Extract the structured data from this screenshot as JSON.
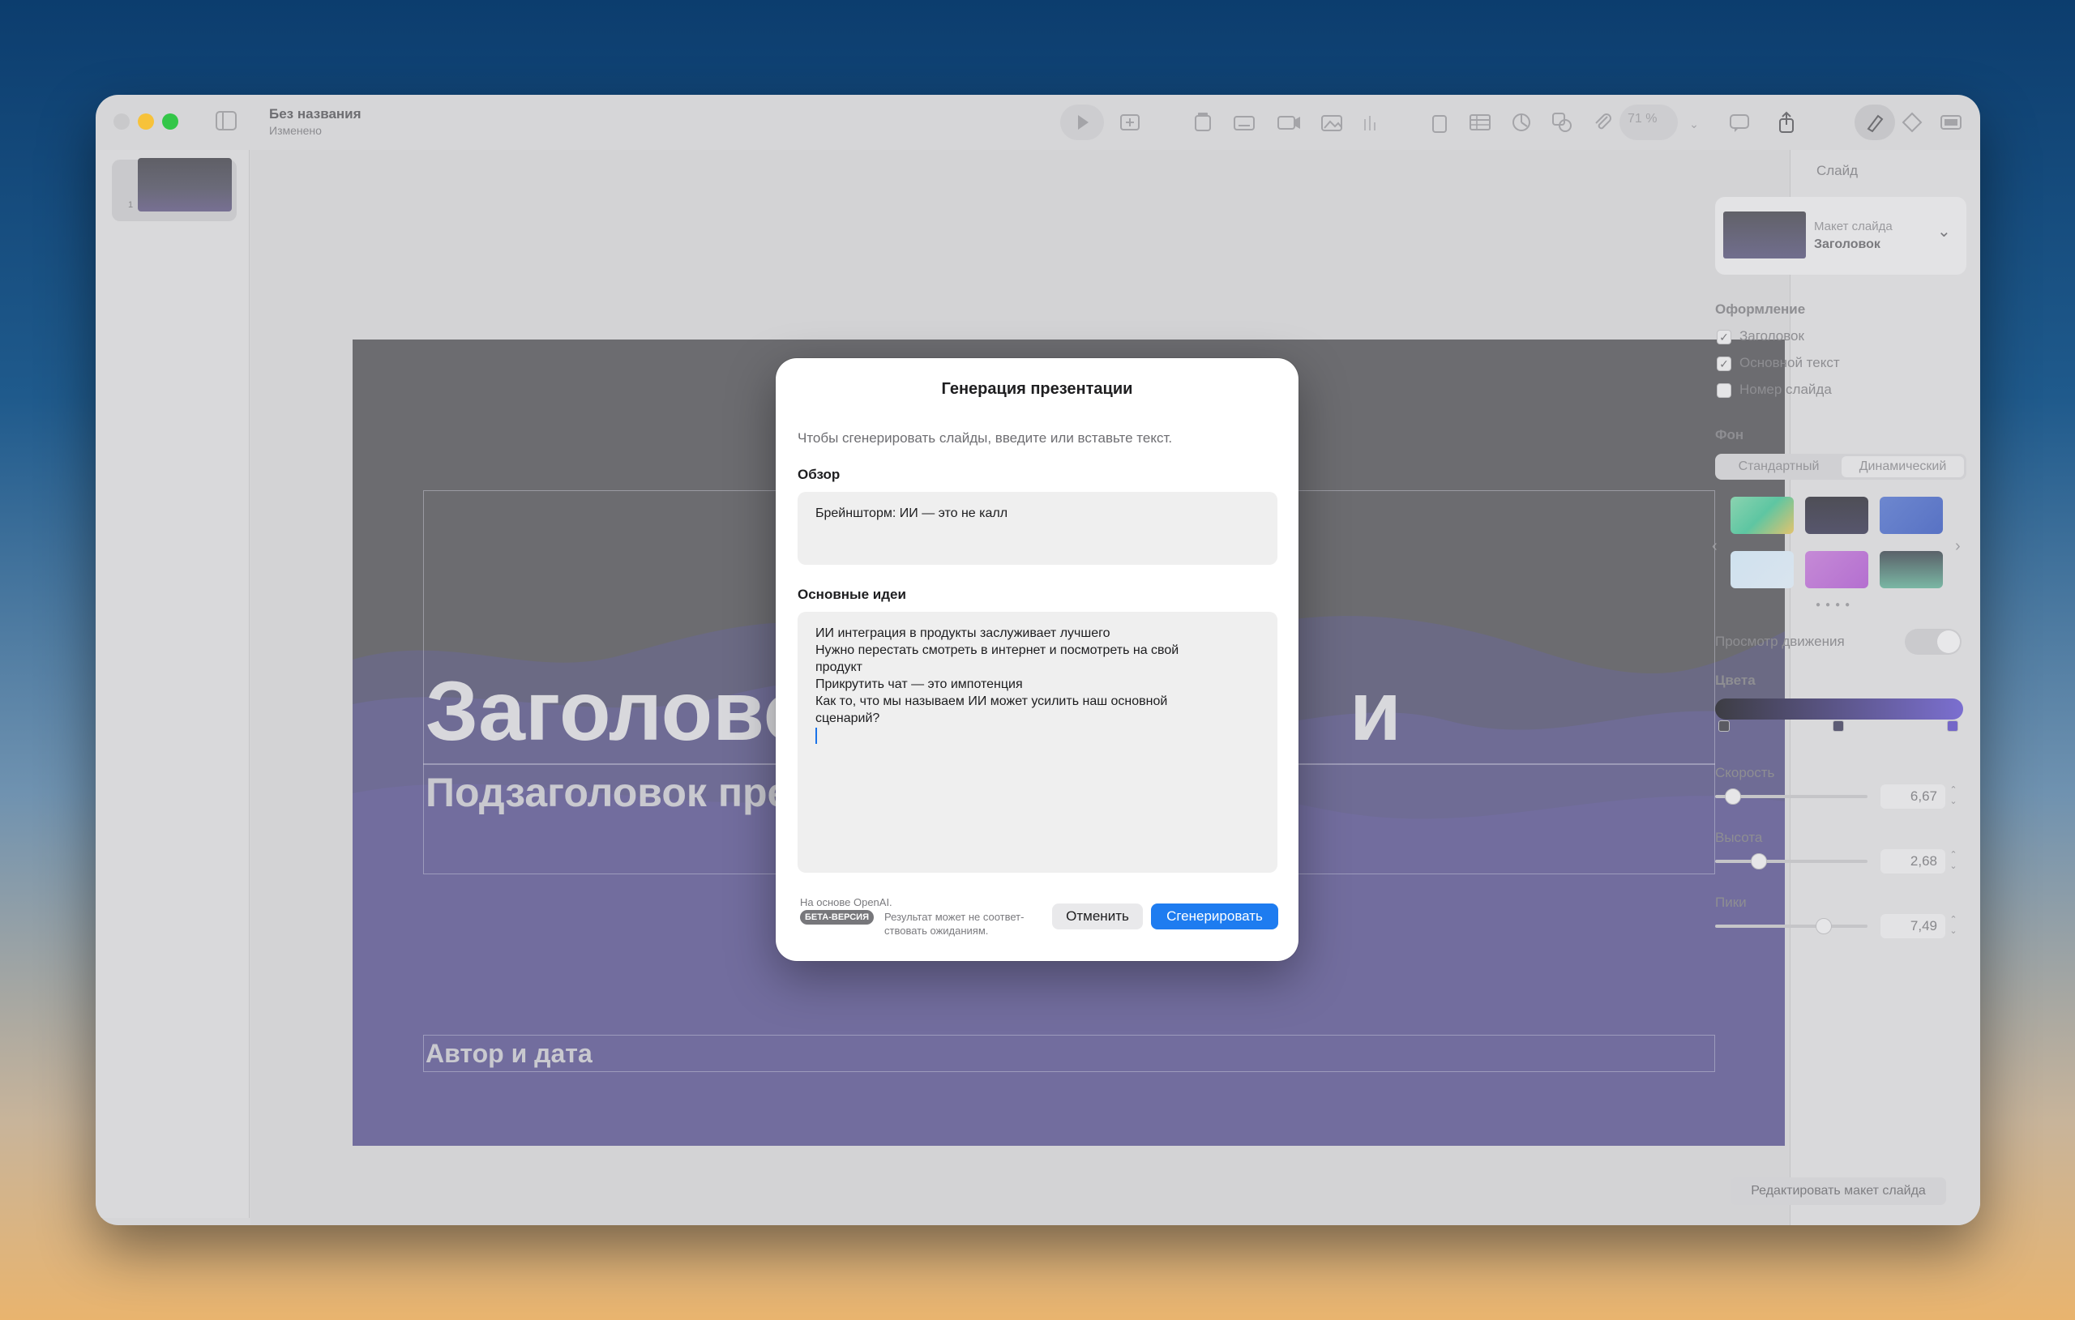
{
  "window": {
    "doc_title": "Без названия",
    "doc_status": "Изменено",
    "zoom": "71 %"
  },
  "navigator": {
    "slide_number": "1"
  },
  "slide": {
    "title_left": "Заголовок",
    "title_right": "и",
    "subtitle": "Подзаголовок презен",
    "author": "Автор и дата"
  },
  "inspector": {
    "header": "Слайд",
    "layout_label": "Макет слайда",
    "layout_value": "Заголовок",
    "appearance_title": "Оформление",
    "checks": [
      {
        "label": "Заголовок",
        "checked": true
      },
      {
        "label": "Основной текст",
        "checked": true
      },
      {
        "label": "Номер слайда",
        "checked": false
      }
    ],
    "background_title": "Фон",
    "bg_standard": "Стандартный",
    "bg_dynamic": "Динамический",
    "motion_preview": "Просмотр движения",
    "colors_title": "Цвета",
    "speed_label": "Скорость",
    "speed_value": "6,67",
    "height_label": "Высота",
    "height_value": "2,68",
    "peaks_label": "Пики",
    "peaks_value": "7,49",
    "edit_layout": "Редактировать макет слайда",
    "accent_colors": [
      "#3d3d44",
      "#7b6fd0"
    ]
  },
  "modal": {
    "title": "Генерация презентации",
    "hint": "Чтобы сгенерировать слайды, введите или вставьте текст.",
    "overview_label": "Обзор",
    "overview_value": "Брейншторм: ИИ — это не калл",
    "ideas_label": "Основные идеи",
    "ideas_lines": [
      "ИИ интеграция в продукты заслуживает лучшего",
      "Нужно перестать смотреть в интернет и посмотреть на свой",
      "продукт",
      "Прикрутить чат — это импотенция",
      "Как то, что мы называем ИИ может усилить наш основной",
      "сценарий?"
    ],
    "powered_by": "На основе OpenAI.",
    "beta": "БЕТА-ВЕРСИЯ",
    "disclaimer_1": "Результат может не соответ-",
    "disclaimer_2": "ствовать ожиданиям.",
    "cancel": "Отменить",
    "generate": "Сгенерировать",
    "accent": "#1e7cf0"
  }
}
